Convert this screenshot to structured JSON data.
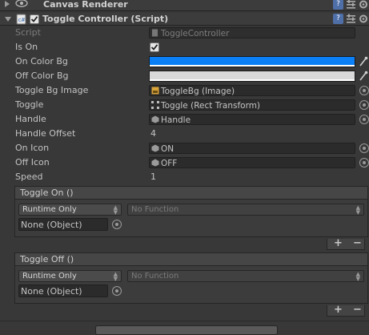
{
  "canvas_renderer": {
    "title": "Canvas Renderer"
  },
  "toggle_controller": {
    "title": "Toggle Controller (Script)",
    "enabled": true,
    "script": {
      "label": "Script",
      "value": "ToggleController"
    },
    "is_on": {
      "label": "Is On",
      "checked": true
    },
    "on_color_bg": {
      "label": "On Color Bg",
      "color": "#0a7ff6"
    },
    "off_color_bg": {
      "label": "Off Color Bg",
      "color": "#d9d9d9"
    },
    "toggle_bg_image": {
      "label": "Toggle Bg Image",
      "value": "ToggleBg (Image)"
    },
    "toggle": {
      "label": "Toggle",
      "value": "Toggle (Rect Transform)"
    },
    "handle": {
      "label": "Handle",
      "value": "Handle"
    },
    "handle_offset": {
      "label": "Handle Offset",
      "value": "4"
    },
    "on_icon": {
      "label": "On Icon",
      "value": "ON"
    },
    "off_icon": {
      "label": "Off Icon",
      "value": "OFF"
    },
    "speed": {
      "label": "Speed",
      "value": "1"
    }
  },
  "events": [
    {
      "title": "Toggle On ()",
      "runtime": "Runtime Only",
      "function": "No Function",
      "object": "None (Object)"
    },
    {
      "title": "Toggle Off ()",
      "runtime": "Runtime Only",
      "function": "No Function",
      "object": "None (Object)"
    }
  ],
  "list_buttons": {
    "add": "+",
    "remove": "−"
  },
  "colors": {
    "background": "#383838",
    "header": "#3c3c3c",
    "field": "#2b2b2b",
    "on_color": "#0a7ff6",
    "off_color": "#d9d9d9"
  }
}
